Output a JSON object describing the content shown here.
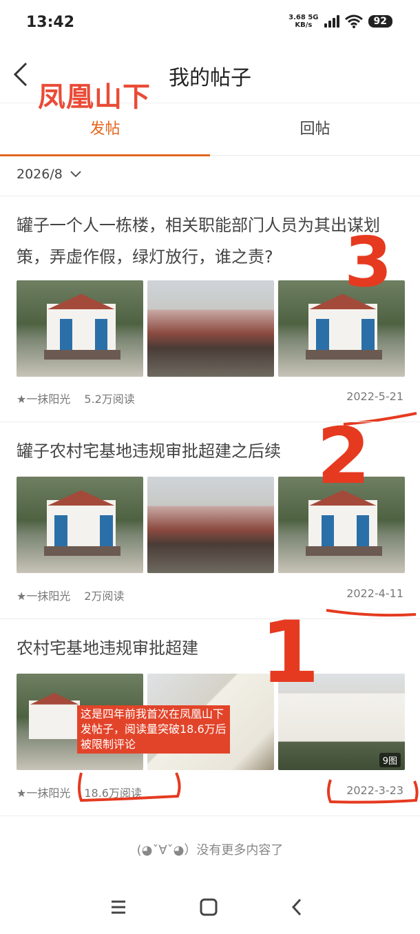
{
  "status_bar": {
    "time": "13:42",
    "net_speed_value": "3.68",
    "net_speed_unit": "KB/s",
    "network_type": "5G",
    "battery": "92"
  },
  "header": {
    "title": "我的帖子",
    "overlay_text": "凤凰山下"
  },
  "tabs": [
    {
      "label": "发帖",
      "active": true
    },
    {
      "label": "回帖",
      "active": false
    }
  ],
  "filter": {
    "month": "2026/8"
  },
  "posts": [
    {
      "title": "罐子一个人一栋楼，相关职能部门人员为其出谋划策，弄虚作假，绿灯放行，谁之责?",
      "author": "★一抹阳光",
      "reads": "5.2万阅读",
      "date": "2022-5-21",
      "marker": "3"
    },
    {
      "title": "罐子农村宅基地违规审批超建之后续",
      "author": "★一抹阳光",
      "reads": "2万阅读",
      "date": "2022-4-11",
      "marker": "2"
    },
    {
      "title": "农村宅基地违规审批超建",
      "author": "★一抹阳光",
      "reads": "18.6万阅读",
      "date": "2022-3-23",
      "marker": "1",
      "image_count": "9图",
      "note": "这是四年前我首次在凤凰山下发帖子，阅读量突破18.6万后被限制评论"
    }
  ],
  "footer": {
    "end_text": "(◕ˇ∀ˇ◕）没有更多内容了"
  },
  "colors": {
    "accent": "#e2661d",
    "annotation_red": "#e53a20"
  }
}
